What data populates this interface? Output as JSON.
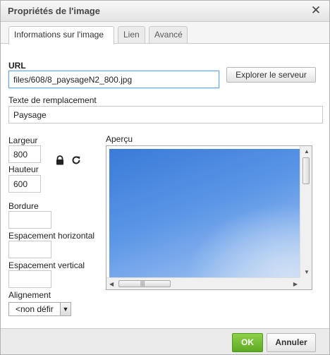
{
  "dialog": {
    "title": "Propriétés de l'image",
    "close_icon": "close-icon"
  },
  "tabs": [
    {
      "label": "Informations sur l'image",
      "active": true
    },
    {
      "label": "Lien",
      "active": false
    },
    {
      "label": "Avancé",
      "active": false
    }
  ],
  "info": {
    "url_label": "URL",
    "url_value": "files/608/8_paysageN2_800.jpg",
    "browse_button": "Explorer le serveur",
    "alt_label": "Texte de remplacement",
    "alt_value": "Paysage",
    "width_label": "Largeur",
    "width_value": "800",
    "height_label": "Hauteur",
    "height_value": "600",
    "lock_icon": "lock-icon",
    "reset_icon": "reset-size-icon",
    "border_label": "Bordure",
    "border_value": "",
    "hspace_label": "Espacement horizontal",
    "hspace_value": "",
    "vspace_label": "Espacement vertical",
    "vspace_value": "",
    "align_label": "Alignement",
    "align_value": "<non défir",
    "preview_label": "Aperçu"
  },
  "footer": {
    "ok_label": "OK",
    "cancel_label": "Annuler",
    "ok_color": "#6bb82a"
  }
}
